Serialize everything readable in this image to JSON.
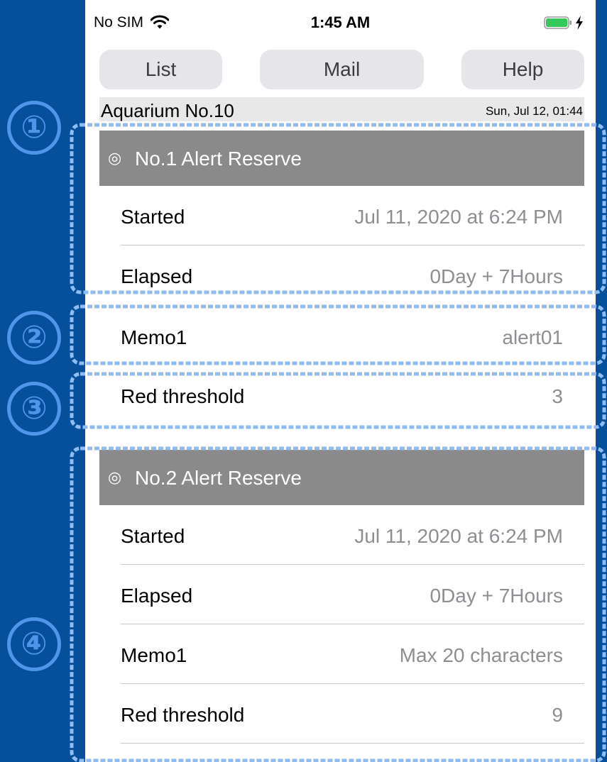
{
  "status_bar": {
    "carrier": "No SIM",
    "time": "1:45 AM"
  },
  "nav": {
    "list_label": "List",
    "mail_label": "Mail",
    "help_label": "Help"
  },
  "header": {
    "title": "Aquarium No.10",
    "datetime": "Sun, Jul 12, 01:44"
  },
  "sections": [
    {
      "glyph": "◎",
      "title": "No.1 Alert Reserve",
      "rows": [
        {
          "label": "Started",
          "value": "Jul 11, 2020 at 6:24 PM"
        },
        {
          "label": "Elapsed",
          "value": "0Day + 7Hours"
        },
        {
          "label": "Memo1",
          "value": "alert01"
        },
        {
          "label": "Red threshold",
          "value": "3"
        }
      ]
    },
    {
      "glyph": "◎",
      "title": "No.2 Alert Reserve",
      "rows": [
        {
          "label": "Started",
          "value": "Jul 11, 2020 at 6:24 PM"
        },
        {
          "label": "Elapsed",
          "value": "0Day + 7Hours"
        },
        {
          "label": "Memo1",
          "value": "Max 20 characters"
        },
        {
          "label": "Red threshold",
          "value": "9"
        }
      ]
    }
  ],
  "annotations": [
    "①",
    "②",
    "③",
    "④"
  ],
  "colors": {
    "background": "#064f9a",
    "annotation": "#4f95e9",
    "section_header": "#8a8a8a",
    "battery": "#34c759"
  }
}
